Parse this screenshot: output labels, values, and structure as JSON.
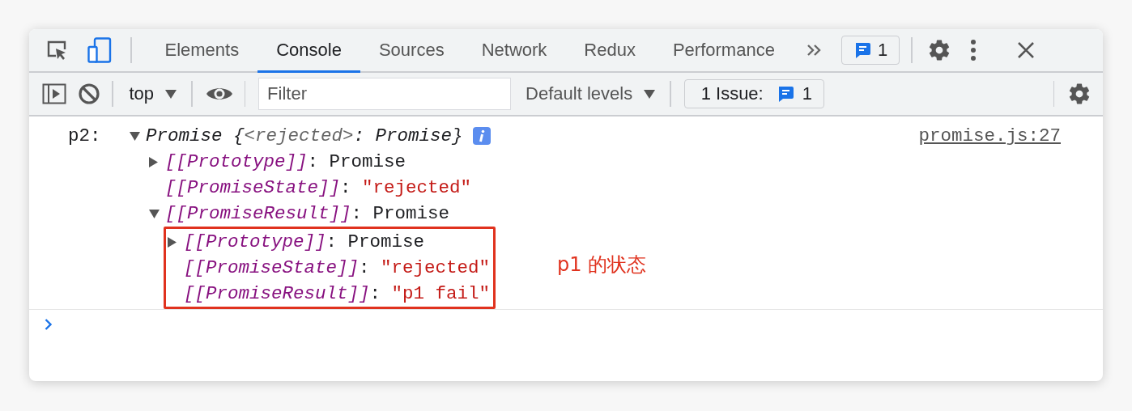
{
  "tabs": [
    {
      "label": "Elements",
      "selected": false
    },
    {
      "label": "Console",
      "selected": true
    },
    {
      "label": "Sources",
      "selected": false
    },
    {
      "label": "Network",
      "selected": false
    },
    {
      "label": "Redux",
      "selected": false
    },
    {
      "label": "Performance",
      "selected": false
    }
  ],
  "messages_badge": "1",
  "toolbar": {
    "context": "top",
    "filter_placeholder": "Filter",
    "levels": "Default levels",
    "issues_label": "1 Issue:",
    "issues_count": "1"
  },
  "console": {
    "label": "p2:",
    "source": "promise.js:27",
    "separator": ":",
    "summary": [
      {
        "text": "Promise {",
        "kind": "plain"
      },
      {
        "text": "<rejected>",
        "kind": "dim"
      },
      {
        "text": ": Promise}",
        "kind": "plain"
      }
    ],
    "expanded": true,
    "children": [
      {
        "key": "[[Prototype]]",
        "value": "Promise",
        "kind": "object",
        "expanded": false
      },
      {
        "key": "[[PromiseState]]",
        "value": "\"rejected\"",
        "kind": "string"
      },
      {
        "key": "[[PromiseResult]]",
        "value": "Promise",
        "kind": "object",
        "expanded": true,
        "highlighted": true,
        "children": [
          {
            "key": "[[Prototype]]",
            "value": "Promise",
            "kind": "object",
            "expanded": false
          },
          {
            "key": "[[PromiseState]]",
            "value": "\"rejected\"",
            "kind": "string"
          },
          {
            "key": "[[PromiseResult]]",
            "value": "\"p1 fail\"",
            "kind": "string"
          }
        ]
      }
    ]
  },
  "annotation": "p1 的状态"
}
